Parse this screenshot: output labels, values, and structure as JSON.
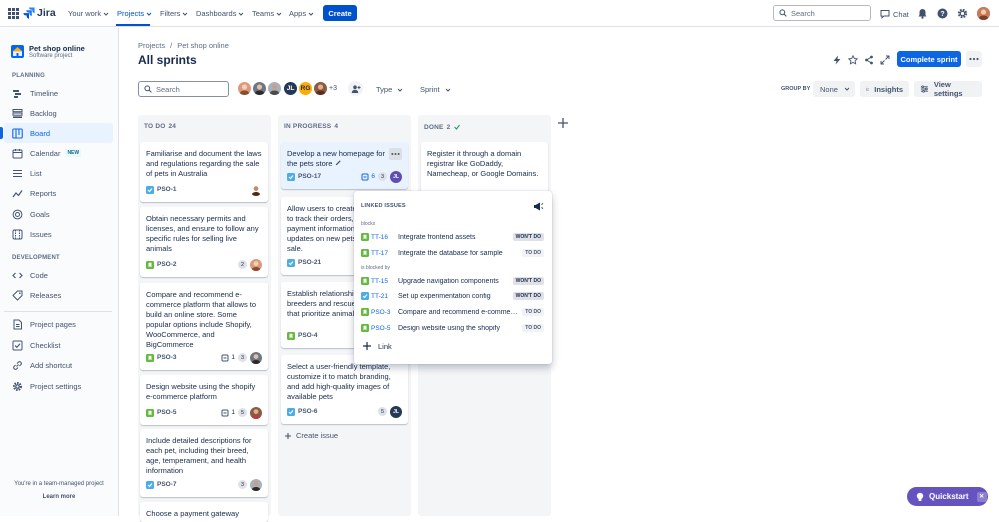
{
  "topnav": {
    "logo": "Jira",
    "items": [
      "Your work",
      "Projects",
      "Filters",
      "Dashboards",
      "Teams",
      "Apps"
    ],
    "create": "Create",
    "search_placeholder": "Search",
    "chat": "Chat"
  },
  "sidebar": {
    "project_name": "Pet shop online",
    "project_type": "Software project",
    "planning_label": "PLANNING",
    "planning": [
      {
        "label": "Timeline",
        "icon": "timeline-icon"
      },
      {
        "label": "Backlog",
        "icon": "backlog-icon"
      },
      {
        "label": "Board",
        "icon": "board-icon"
      },
      {
        "label": "Calendar",
        "icon": "calendar-icon",
        "badge": "NEW"
      },
      {
        "label": "List",
        "icon": "list-icon"
      },
      {
        "label": "Reports",
        "icon": "reports-icon"
      },
      {
        "label": "Goals",
        "icon": "goals-icon"
      },
      {
        "label": "Issues",
        "icon": "issues-icon"
      }
    ],
    "development_label": "DEVELOPMENT",
    "development": [
      {
        "label": "Code",
        "icon": "code-icon"
      },
      {
        "label": "Releases",
        "icon": "releases-icon"
      }
    ],
    "other": [
      {
        "label": "Project pages",
        "icon": "pages-icon"
      },
      {
        "label": "Checklist",
        "icon": "checklist-icon"
      },
      {
        "label": "Add shortcut",
        "icon": "add-shortcut-icon"
      },
      {
        "label": "Project settings",
        "icon": "settings-icon"
      }
    ],
    "team_text": "You're in a team-managed project",
    "learn_more": "Learn more"
  },
  "header": {
    "breadcrumb": [
      "Projects",
      "/",
      "Pet shop online"
    ],
    "title": "All sprints",
    "complete_sprint": "Complete sprint"
  },
  "toolbar": {
    "search_placeholder": "Search",
    "avatar_initials": [
      "JL",
      "RG"
    ],
    "more_avatars": "+3",
    "type": "Type",
    "sprint": "Sprint",
    "group_by_label": "GROUP BY",
    "group_by_value": "None",
    "insights": "Insights",
    "view_settings": "View settings"
  },
  "columns": [
    {
      "name": "TO DO",
      "count": "24"
    },
    {
      "name": "IN PROGRESS",
      "count": "4"
    },
    {
      "name": "DONE",
      "count": "2"
    }
  ],
  "todo_cards": [
    {
      "text": "Familiarise and document the laws and regulations regarding the sale of pets in Australia",
      "key": "PSO-1",
      "type": "task"
    },
    {
      "text": "Obtain necessary permits and licenses, and ensure to follow any specific rules for selling live animals",
      "key": "PSO-2",
      "type": "story",
      "points": "2"
    },
    {
      "text": "Compare and recommend e-commerce platform that allows to build an online store. Some popular options include Shopify, WooCommerce, and BigCommerce",
      "key": "PSO-3",
      "type": "story",
      "subtasks": "1",
      "points": "3"
    },
    {
      "text": "Design website using the shopify e-commerce platform",
      "key": "PSO-5",
      "type": "story",
      "subtasks": "1",
      "points": "5"
    },
    {
      "text": "Include detailed descriptions for each pet, including their breed, age, temperament, and health information",
      "key": "PSO-7",
      "type": "task",
      "points": "3"
    },
    {
      "text": "Choose a payment gateway"
    }
  ],
  "inprogress_cards": [
    {
      "text": "Develop a new homepage for the pets store",
      "key": "PSO-17",
      "type": "task",
      "subtasks": "6",
      "points": "3",
      "assignee": "JL"
    },
    {
      "text": "Allow users to create an account to track their orders, save payment information, and receive updates on new pets available for sale.",
      "key": "PSO-21",
      "type": "task"
    },
    {
      "text": "Establish relationships with ethical breeders and rescue agencies that prioritize animal welfare",
      "key": "PSO-4",
      "type": "story"
    },
    {
      "text": "Select a user-friendly template, customize it to match branding, and add high-quality images of available pets",
      "key": "PSO-6",
      "type": "task",
      "points": "5",
      "assignee": "JL"
    }
  ],
  "create_issue": "Create issue",
  "done_cards": [
    {
      "text": "Register it through a domain registrar like GoDaddy, Namecheap, or Google Domains."
    }
  ],
  "linked_issues": {
    "title": "LINKED ISSUES",
    "blocks_label": "blocks",
    "blocks": [
      {
        "key": "TT-16",
        "summary": "Integrate frontend assets",
        "status": "WON'T DO",
        "type": "story"
      },
      {
        "key": "TT-17",
        "summary": "Integrate the database for sample",
        "status": "TO DO",
        "type": "story"
      }
    ],
    "blocked_label": "is blocked by",
    "blocked_by": [
      {
        "key": "TT-15",
        "summary": "Upgrade navigation components",
        "status": "WON'T DO",
        "type": "story"
      },
      {
        "key": "TT-21",
        "summary": "Set up experimentation config",
        "status": "WON'T DO",
        "type": "task"
      },
      {
        "key": "PSO-3",
        "summary": "Compare and recommend e-commerce",
        "status": "TO DO",
        "type": "story"
      },
      {
        "key": "PSO-5",
        "summary": "Design website using the shopify",
        "status": "TO DO",
        "type": "story"
      }
    ],
    "link": "Link"
  },
  "quickstart": "Quickstart",
  "colors": {
    "brand": "#0052cc",
    "task": "#4bade8",
    "story": "#63ba3c",
    "quickstart": "#6554c0"
  }
}
